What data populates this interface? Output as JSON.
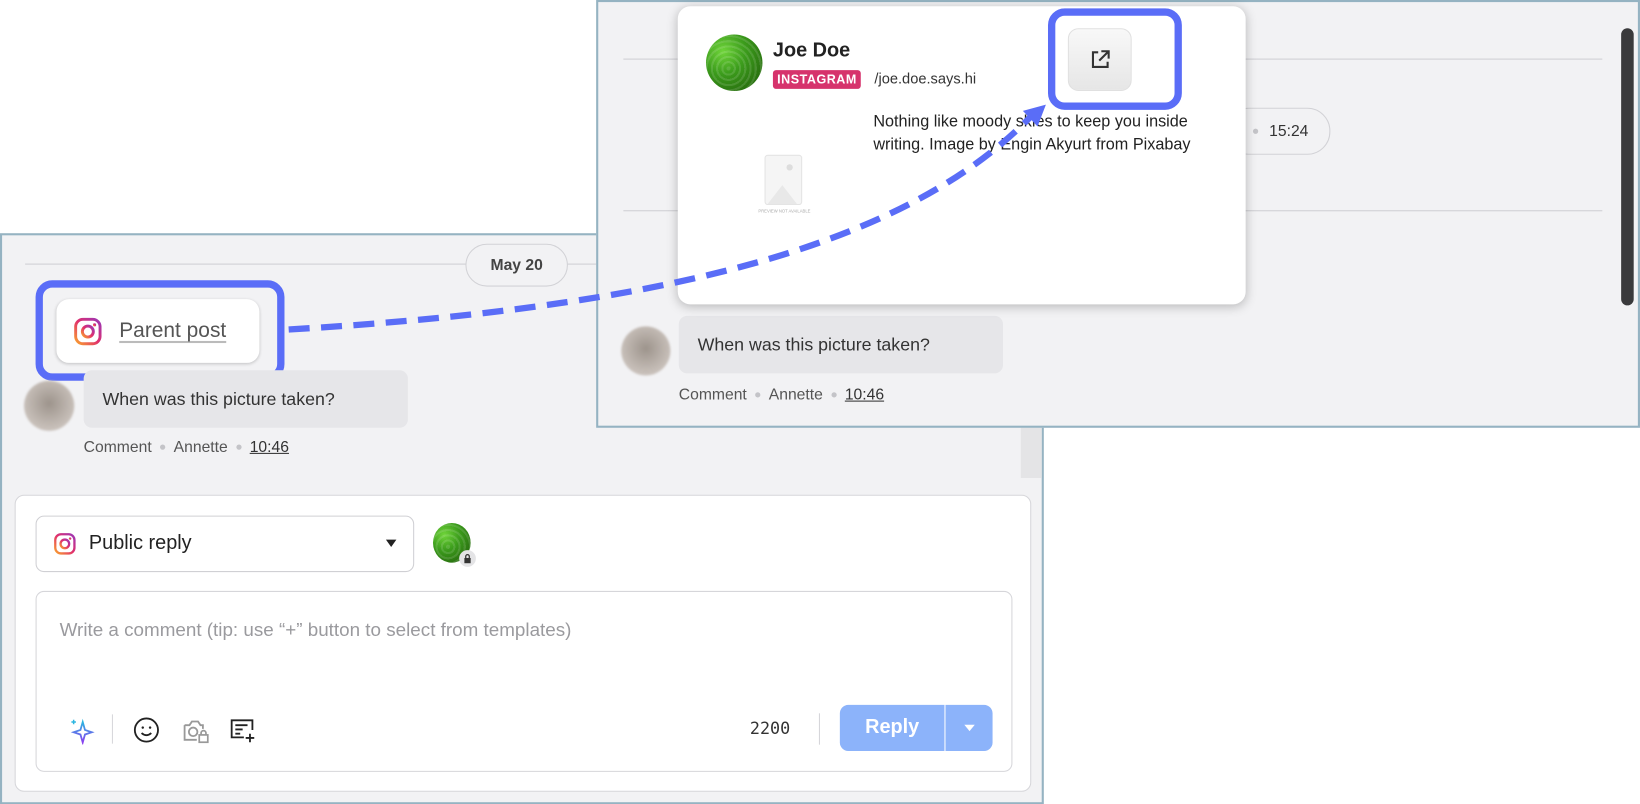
{
  "left_panel": {
    "date_label": "May 20",
    "parent_post_label": "Parent post",
    "comment": {
      "text": "When was this picture taken?",
      "type": "Comment",
      "author": "Annette",
      "time": "10:46"
    },
    "reply_box": {
      "channel_select": "Public reply",
      "placeholder": "Write a comment (tip: use “+” button to select from templates)",
      "char_count": "2200",
      "reply_label": "Reply"
    }
  },
  "right_panel": {
    "time_pill": "15:24",
    "comment": {
      "text": "When was this picture taken?",
      "type": "Comment",
      "author": "Annette",
      "time": "10:46"
    },
    "popover": {
      "name": "Joe Doe",
      "network_badge": "INSTAGRAM",
      "handle": "/joe.doe.says.hi",
      "description": "Nothing like moody skies to keep you inside writing.  Image by Engin Akyurt from Pixabay",
      "preview_text": "PREVIEW NOT AVAILABLE"
    }
  },
  "colors": {
    "highlight": "#5a6df7",
    "instagram_badge": "#d6336c",
    "reply_button": "#8cb3fa"
  }
}
